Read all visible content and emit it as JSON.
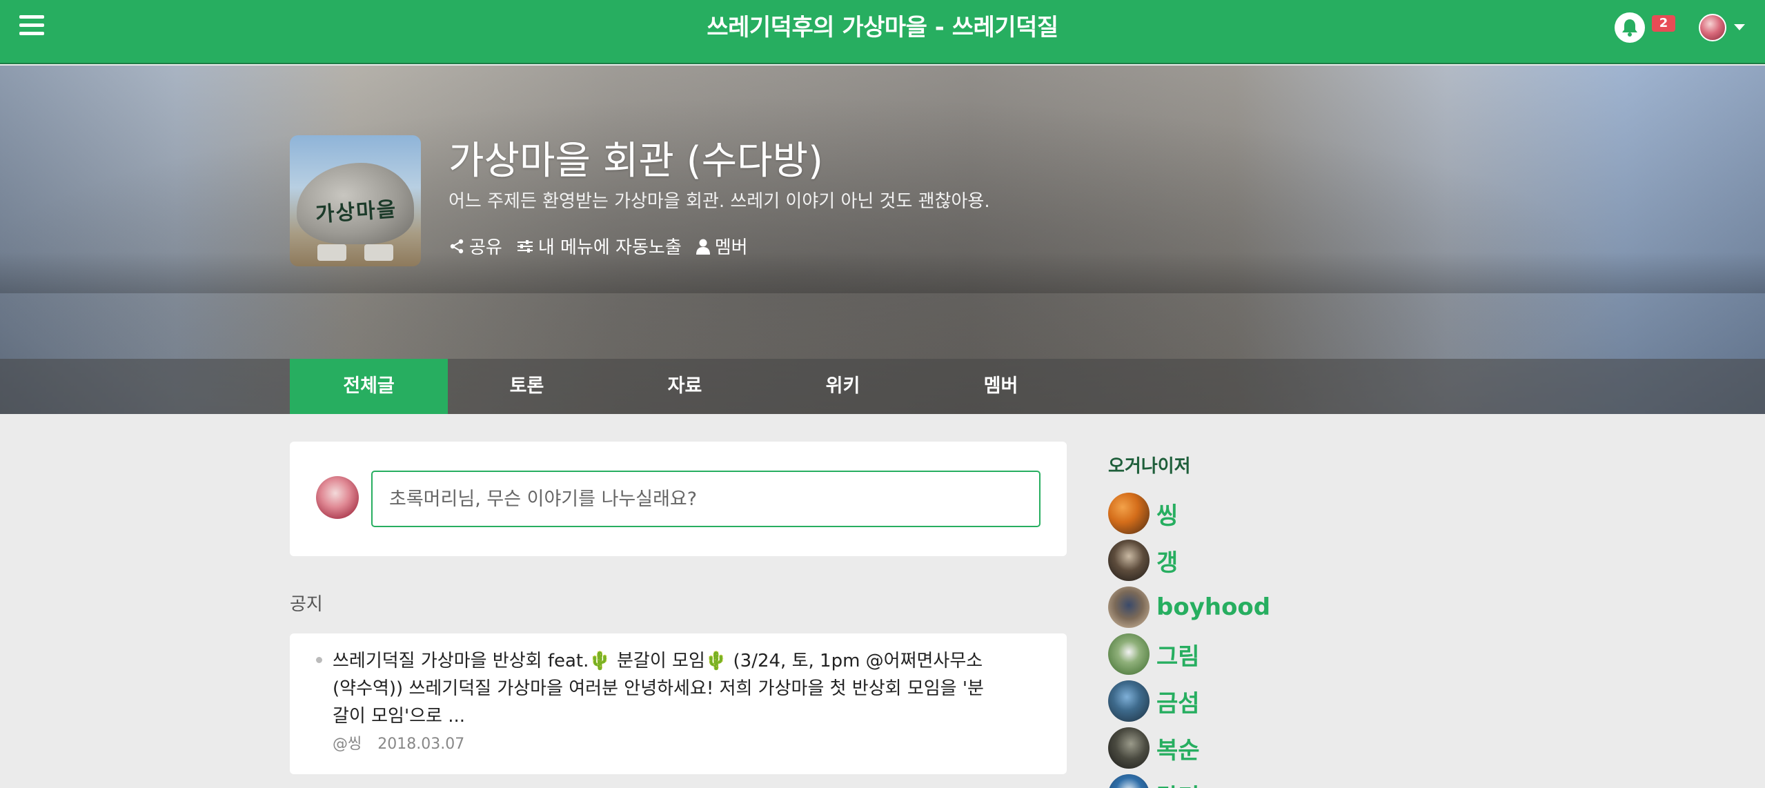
{
  "header": {
    "site_title": "쓰레기덕후의 가상마을 - 쓰레기덕질",
    "notification_count": "2",
    "menu_icon": "hamburger-icon",
    "bell_icon": "bell-icon",
    "accent_color": "#27ae60"
  },
  "group": {
    "thumbnail_text": "가상마을",
    "title": "가상마을 회관 (수다방)",
    "description": "어느 주제든 환영받는 가상마을 회관. 쓰레기 이야기 아닌 것도 괜찮아용.",
    "actions": [
      {
        "label": "공유",
        "icon": "share-icon"
      },
      {
        "label": "내 메뉴에 자동노출",
        "icon": "sliders-icon"
      },
      {
        "label": "멤버",
        "icon": "user-icon"
      }
    ]
  },
  "tabs": [
    {
      "label": "전체글",
      "active": true
    },
    {
      "label": "토론",
      "active": false
    },
    {
      "label": "자료",
      "active": false
    },
    {
      "label": "위키",
      "active": false
    },
    {
      "label": "멤버",
      "active": false
    }
  ],
  "composer": {
    "placeholder": "초록머리님, 무슨 이야기를 나누실래요?"
  },
  "notice": {
    "section_label": "공지",
    "items": [
      {
        "text": "쓰레기덕질 가상마을 반상회 feat.🌵  분갈이 모임🌵  (3/24, 토, 1pm @어쩌면사무소 (약수역))   쓰레기덕질 가상마을 여러분 안녕하세요!  저희 가상마을 첫 반상회 모임을 '분갈이 모임'으로 ...",
        "author": "@씽",
        "date": "2018.03.07"
      }
    ]
  },
  "sidebar": {
    "organizer_title": "오거나이저",
    "organizers": [
      {
        "name": "씽"
      },
      {
        "name": "갱"
      },
      {
        "name": "boyhood"
      },
      {
        "name": "그림"
      },
      {
        "name": "금섬"
      },
      {
        "name": "복순"
      },
      {
        "name": "달리"
      }
    ]
  }
}
